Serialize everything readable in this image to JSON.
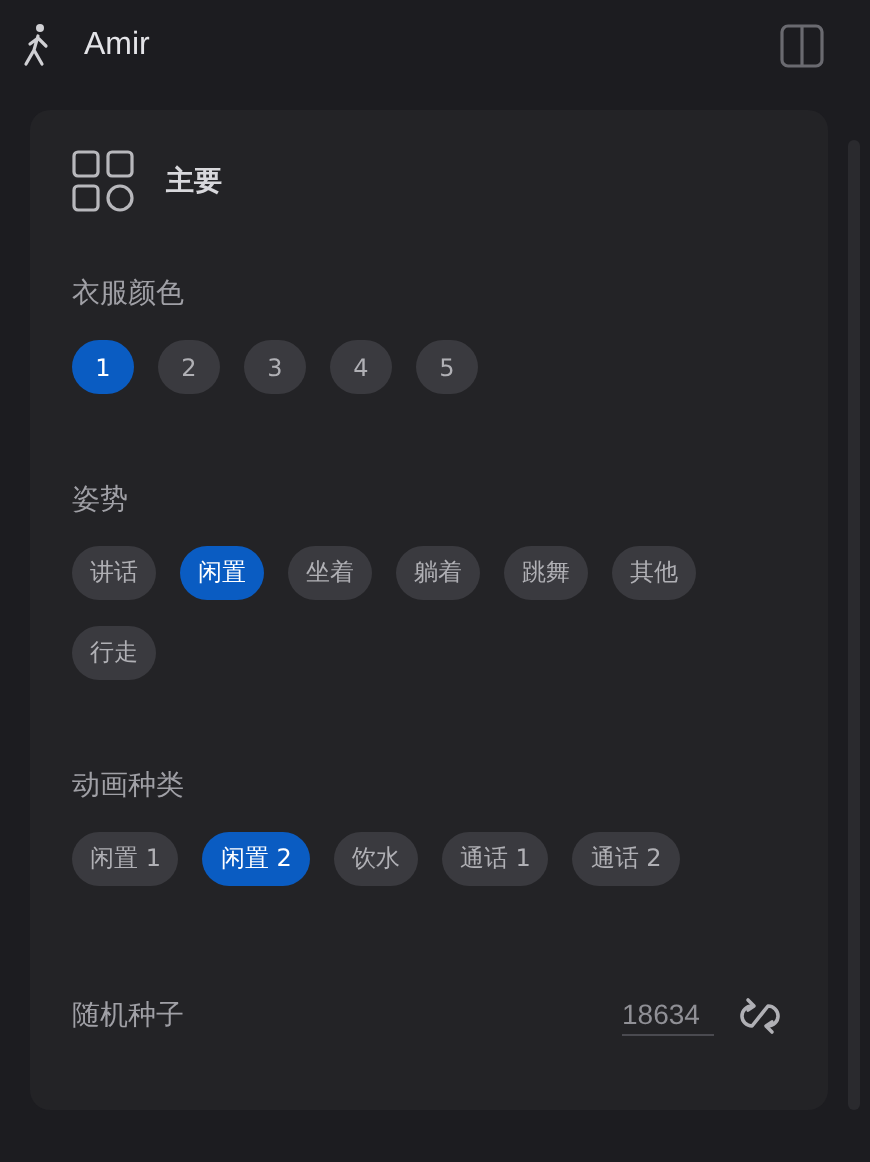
{
  "header": {
    "title": "Amir"
  },
  "card": {
    "title": "主要",
    "sections": [
      {
        "kind": "chips",
        "label": "衣服颜色",
        "options": [
          {
            "label": "1",
            "selected": true
          },
          {
            "label": "2",
            "selected": false
          },
          {
            "label": "3",
            "selected": false
          },
          {
            "label": "4",
            "selected": false
          },
          {
            "label": "5",
            "selected": false
          }
        ]
      },
      {
        "kind": "chips",
        "label": "姿势",
        "options": [
          {
            "label": "讲话",
            "selected": false
          },
          {
            "label": "闲置",
            "selected": true
          },
          {
            "label": "坐着",
            "selected": false
          },
          {
            "label": "躺着",
            "selected": false
          },
          {
            "label": "跳舞",
            "selected": false
          },
          {
            "label": "其他",
            "selected": false
          },
          {
            "label": "行走",
            "selected": false
          }
        ]
      },
      {
        "kind": "chips",
        "label": "动画种类",
        "options": [
          {
            "label": "闲置 1",
            "selected": false
          },
          {
            "label": "闲置 2",
            "selected": true
          },
          {
            "label": "饮水",
            "selected": false
          },
          {
            "label": "通话 1",
            "selected": false
          },
          {
            "label": "通话 2",
            "selected": false
          }
        ]
      },
      {
        "kind": "seed",
        "label": "随机种子",
        "value": "18634"
      }
    ]
  }
}
